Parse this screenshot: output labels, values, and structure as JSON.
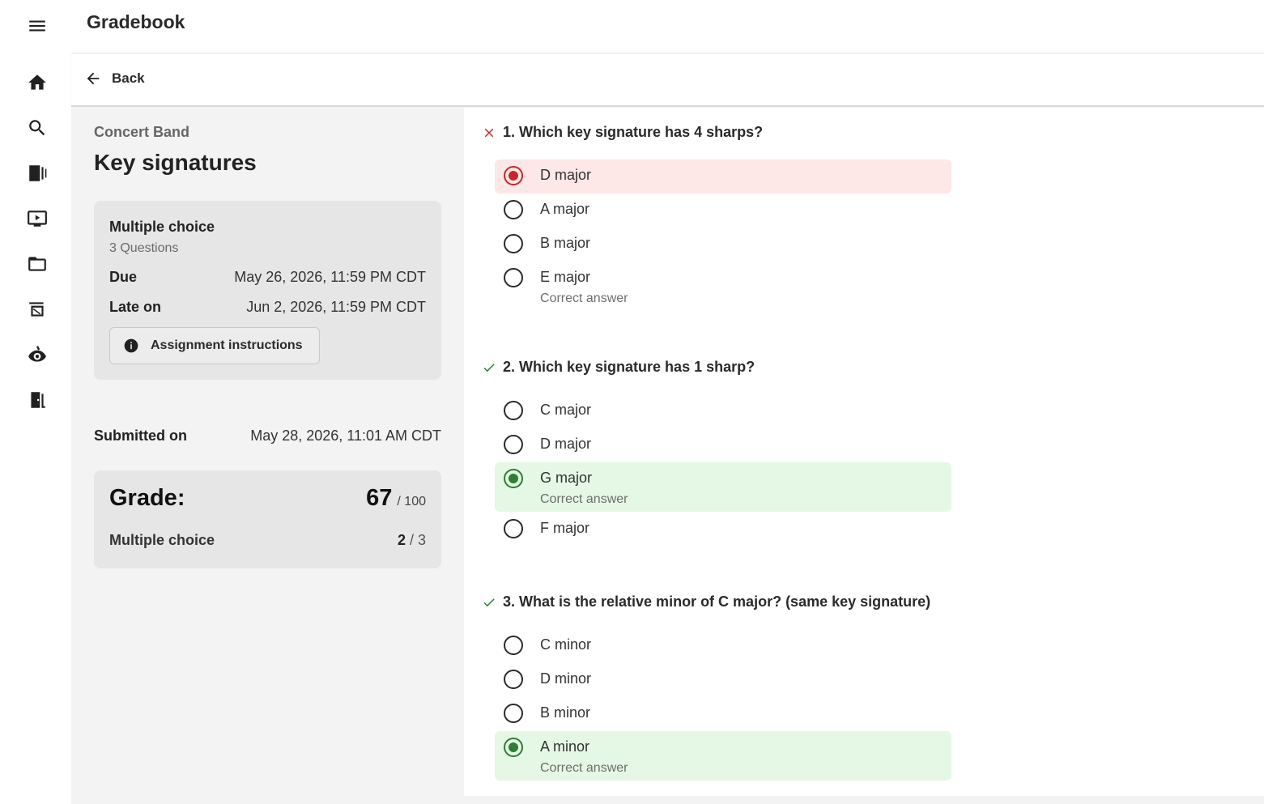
{
  "app": {
    "title": "Gradebook"
  },
  "nav": {
    "back_label": "Back",
    "icons": [
      "menu-icon",
      "home-icon",
      "search-icon",
      "library-icon",
      "video-icon",
      "folder-icon",
      "assignment-icon",
      "eye-icon",
      "exit-icon"
    ]
  },
  "assignment": {
    "course": "Concert Band",
    "title": "Key signatures",
    "type": "Multiple choice",
    "question_count": "3 Questions",
    "due_label": "Due",
    "due_value": "May 26, 2026, 11:59 PM CDT",
    "late_label": "Late on",
    "late_value": "Jun 2, 2026, 11:59 PM CDT",
    "instructions_label": "Assignment instructions",
    "submitted_label": "Submitted on",
    "submitted_value": "May 28, 2026, 11:01 AM CDT"
  },
  "grade": {
    "label": "Grade:",
    "score": "67",
    "out_of": "/ 100",
    "section_label": "Multiple choice",
    "section_score": "2",
    "section_total": "/ 3"
  },
  "colors": {
    "wrong": "#c62828",
    "correct": "#2e7d32",
    "wrong_bg": "#fde7e7",
    "correct_bg": "#e5f7e5"
  },
  "questions": [
    {
      "text": "1. Which key signature has 4 sharps?",
      "status_icon": "x-icon",
      "options": [
        {
          "label": "D major",
          "selected": true,
          "note": ""
        },
        {
          "label": "A major",
          "selected": false,
          "note": ""
        },
        {
          "label": "B major",
          "selected": false,
          "note": ""
        },
        {
          "label": "E major",
          "selected": false,
          "note": "Correct answer"
        }
      ]
    },
    {
      "text": "2. Which key signature has 1 sharp?",
      "status_icon": "check-icon",
      "options": [
        {
          "label": "C major",
          "selected": false,
          "note": ""
        },
        {
          "label": "D major",
          "selected": false,
          "note": ""
        },
        {
          "label": "G major",
          "selected": true,
          "note": "Correct answer"
        },
        {
          "label": "F major",
          "selected": false,
          "note": ""
        }
      ]
    },
    {
      "text": "3. What is the relative minor of C major? (same key signature)",
      "status_icon": "check-icon",
      "options": [
        {
          "label": "C minor",
          "selected": false,
          "note": ""
        },
        {
          "label": "D minor",
          "selected": false,
          "note": ""
        },
        {
          "label": "B minor",
          "selected": false,
          "note": ""
        },
        {
          "label": "A minor",
          "selected": true,
          "note": "Correct answer"
        }
      ]
    }
  ]
}
